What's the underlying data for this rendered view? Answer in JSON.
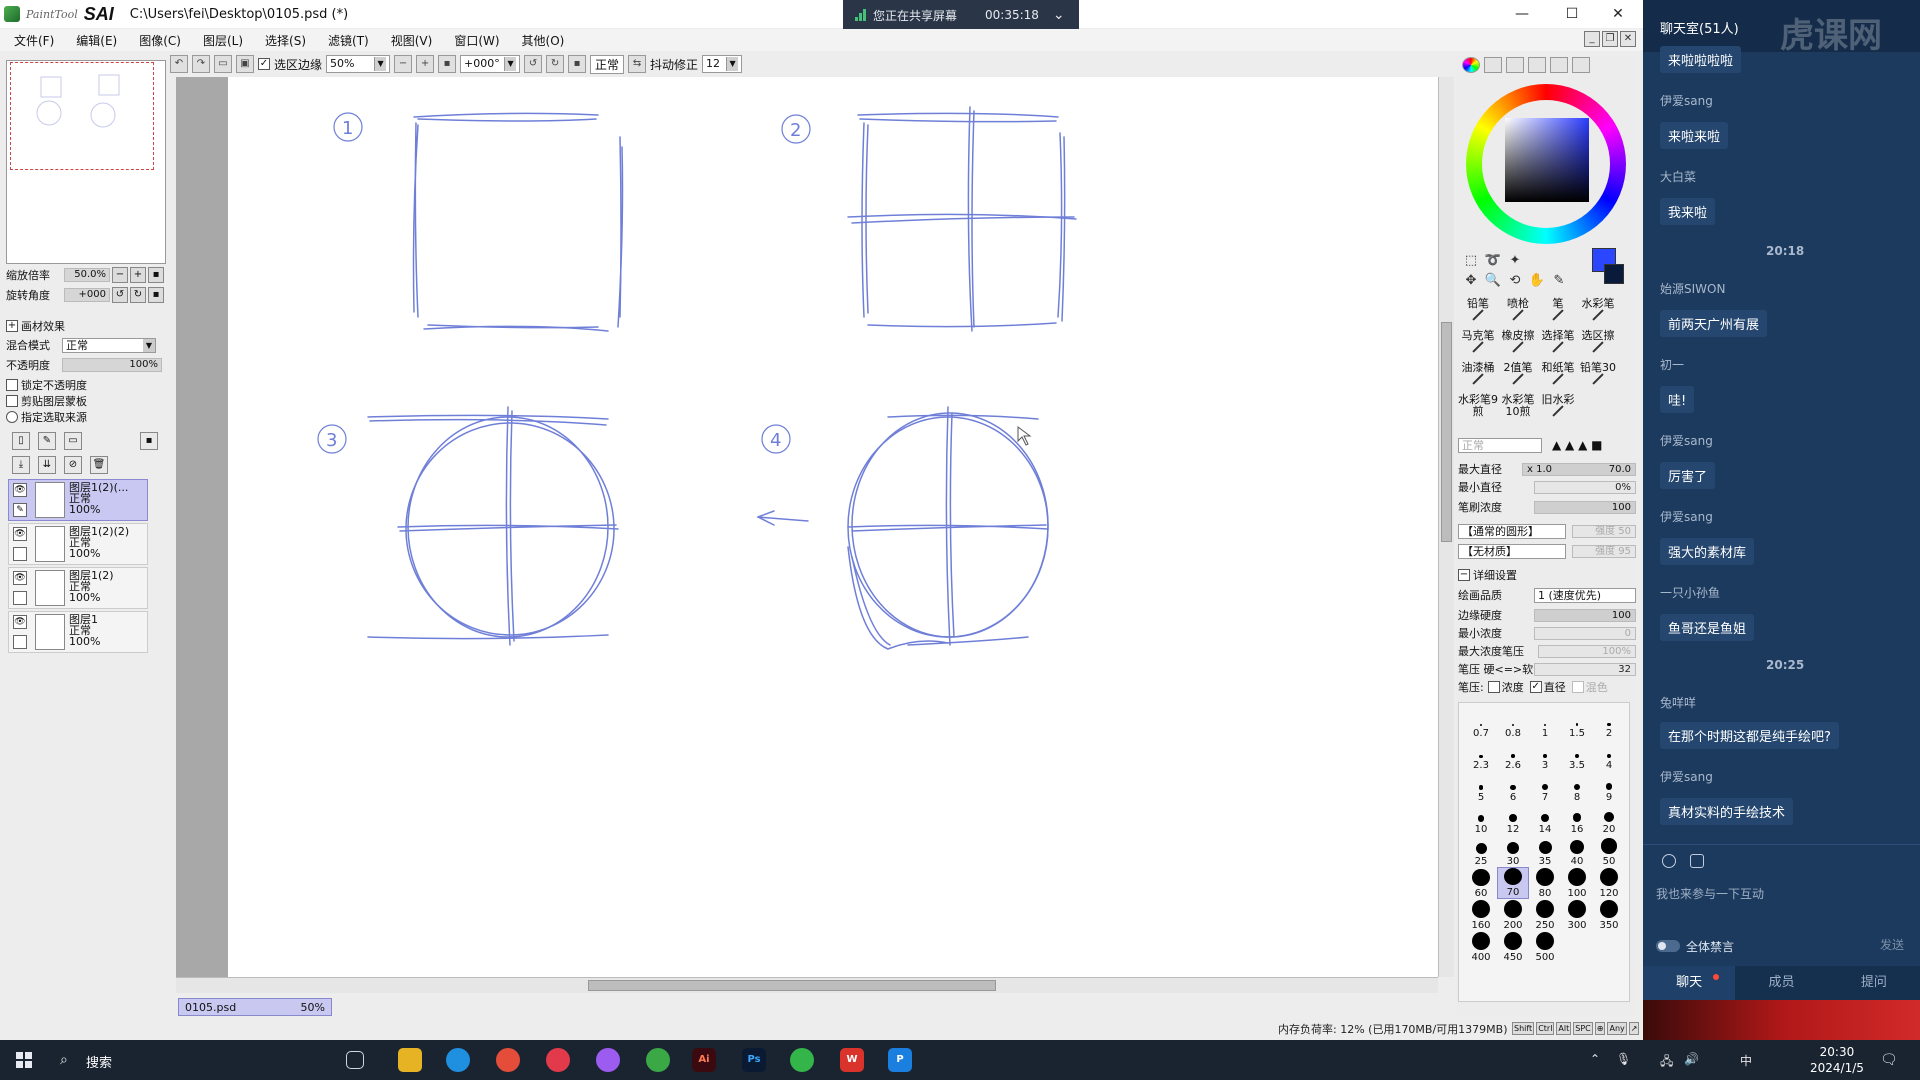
{
  "window": {
    "app_name_small": "PaintTool",
    "app_name_big": "SAI",
    "doc_path": "C:\\Users\\fei\\Desktop\\0105.psd (*)",
    "minimize": "—",
    "maximize": "☐",
    "close": "✕"
  },
  "share_bar": {
    "label": "您正在共享屏幕",
    "time": "00:35:18",
    "chevron": "⌄"
  },
  "menu": [
    "文件(F)",
    "编辑(E)",
    "图像(C)",
    "图层(L)",
    "选择(S)",
    "滤镜(T)",
    "视图(V)",
    "窗口(W)",
    "其他(O)"
  ],
  "toolbar": {
    "selection_edge_label": "选区边缘",
    "selection_edge_checked": "✓",
    "zoom": "50%",
    "angle": "+000°",
    "mode": "正常",
    "stabilizer_label": "抖动修正",
    "stabilizer_value": "12"
  },
  "navigator": {
    "zoom_label": "缩放倍率",
    "zoom_value": "50.0%",
    "angle_label": "旋转角度",
    "angle_value": "+000"
  },
  "layer_props": {
    "texture_effect": "画材效果",
    "blend_label": "混合模式",
    "blend_value": "正常",
    "opacity_label": "不透明度",
    "opacity_value": "100%",
    "lock_opacity": "锁定不透明度",
    "clip_mask": "剪贴图层蒙板",
    "selection_source": "指定选取来源"
  },
  "layers": [
    {
      "name": "图层1(2)(...",
      "mode": "正常",
      "opacity": "100%",
      "selected": true
    },
    {
      "name": "图层1(2)(2)",
      "mode": "正常",
      "opacity": "100%",
      "selected": false
    },
    {
      "name": "图层1(2)",
      "mode": "正常",
      "opacity": "100%",
      "selected": false
    },
    {
      "name": "图层1",
      "mode": "正常",
      "opacity": "100%",
      "selected": false
    }
  ],
  "canvas": {
    "labels": [
      "1",
      "2",
      "3",
      "4"
    ],
    "stroke_color": "#6f7fd8"
  },
  "doc_tab": {
    "name": "0105.psd",
    "zoom": "50%"
  },
  "status": {
    "memory": "内存负荷率: 12% (已用170MB/可用1379MB)",
    "keys": [
      "Shift",
      "Ctrl",
      "Alt",
      "SPC",
      "⊕",
      "Any",
      "↗"
    ]
  },
  "color": {
    "primary": "#2b46ff",
    "secondary": "#0a1a3a"
  },
  "brushes": [
    "铅笔",
    "喷枪",
    "笔",
    "水彩笔",
    "马克笔",
    "橡皮擦",
    "选择笔",
    "选区擦",
    "油漆桶",
    "2值笔",
    "和纸笔",
    "铅笔30",
    "水彩笔9煎",
    "水彩笔10煎",
    "旧水彩",
    ""
  ],
  "brush_params": {
    "mode_placeholder": "正常",
    "max_diameter_label": "最大直径",
    "max_diameter_mult": "x 1.0",
    "max_diameter_value": "70.0",
    "min_diameter_label": "最小直径",
    "min_diameter_value": "0%",
    "density_label": "笔刷浓度",
    "density_value": "100",
    "shape_value": "【通常的圆形】",
    "shape_strength": "强度 50",
    "texture_value": "【无材质】",
    "texture_strength": "强度 95",
    "detail_label": "详细设置",
    "quality_label": "绘画品质",
    "quality_value": "1 (速度优先)",
    "edge_hardness_label": "边缘硬度",
    "edge_hardness_value": "100",
    "min_density_label": "最小浓度",
    "min_density_value": "0",
    "max_density_pressure_label": "最大浓度笔压",
    "max_density_pressure_value": "100%",
    "pressure_label": "笔压 硬<=>软",
    "pressure_value": "32",
    "pressure_opts_label": "笔压:",
    "pressure_density": "浓度",
    "pressure_diameter": "直径",
    "pressure_blend": "混色"
  },
  "brush_sizes": [
    "0.7",
    "0.8",
    "1",
    "1.5",
    "2",
    "2.3",
    "2.6",
    "3",
    "3.5",
    "4",
    "5",
    "6",
    "7",
    "8",
    "9",
    "10",
    "12",
    "14",
    "16",
    "20",
    "25",
    "30",
    "35",
    "40",
    "50",
    "60",
    "70",
    "80",
    "100",
    "120",
    "160",
    "200",
    "250",
    "300",
    "350",
    "400",
    "450",
    "500"
  ],
  "brush_size_selected": "70",
  "chat": {
    "title": "聊天室(51人)",
    "watermark": "虎课网",
    "messages": [
      {
        "name": "",
        "text": "来啦啦啦啦"
      },
      {
        "name": "伊爱sang",
        "text": "来啦来啦"
      },
      {
        "name": "大白菜",
        "text": "我来啦"
      },
      {
        "time": "20:18"
      },
      {
        "name": "始源SIWON",
        "text": "前两天广州有展"
      },
      {
        "name": "初一",
        "text": "哇!"
      },
      {
        "name": "伊爱sang",
        "text": "厉害了"
      },
      {
        "name": "伊爱sang",
        "text": "强大的素材库"
      },
      {
        "name": "一只小孙鱼",
        "text": "鱼哥还是鱼姐"
      },
      {
        "time": "20:25"
      },
      {
        "name": "兔咩咩",
        "text": "在那个时期这都是纯手绘吧?"
      },
      {
        "name": "伊爱sang",
        "text": "真材实料的手绘技术"
      }
    ],
    "input_placeholder": "我也来参与一下互动",
    "mute_all": "全体禁言",
    "send": "发送",
    "tabs": [
      "聊天",
      "成员",
      "提问"
    ]
  },
  "taskbar": {
    "search": "搜索",
    "time": "20:30",
    "date": "2024/1/5",
    "ime": "中",
    "apps": [
      "Ai",
      "Ps",
      "W",
      "P"
    ]
  }
}
